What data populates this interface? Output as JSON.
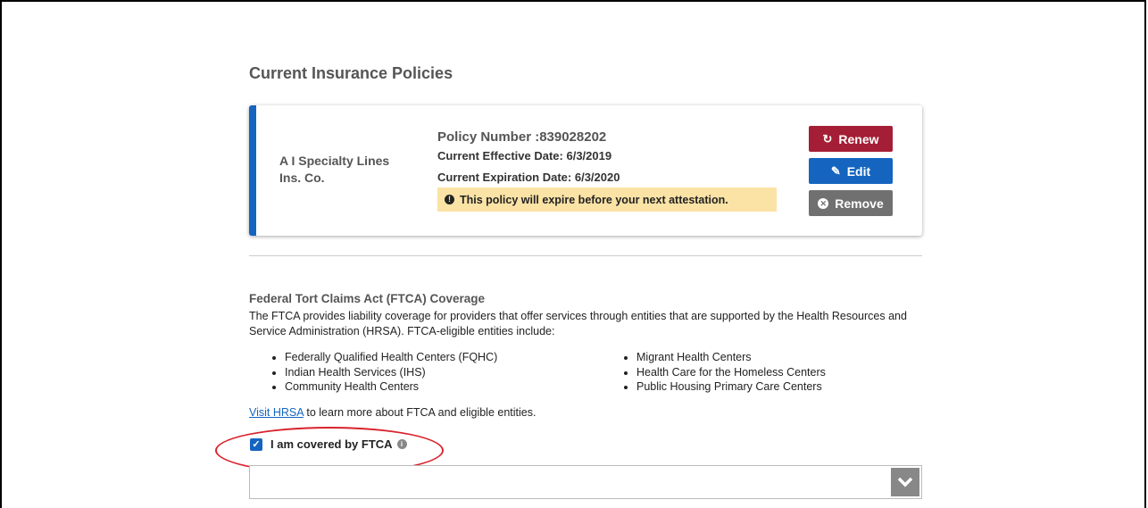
{
  "page": {
    "section_title": "Current Insurance Policies"
  },
  "policy": {
    "insurer": "A I Specialty Lines Ins. Co.",
    "policy_number": "Policy Number :839028202",
    "effective_date": "Current Effective Date: 6/3/2019",
    "expiration_date": "Current Expiration Date: 6/3/2020",
    "warning": "This policy will expire before your next attestation.",
    "renew_label": "Renew",
    "edit_label": "Edit",
    "remove_label": "Remove"
  },
  "ftca": {
    "title": "Federal Tort Claims Act (FTCA) Coverage",
    "description": "The FTCA provides liability coverage for providers that offer services through entities that are supported by the Health Resources and Service Administration (HRSA). FTCA-eligible entities include:",
    "entities_left": [
      "Federally Qualified Health Centers (FQHC)",
      "Indian Health Services (IHS)",
      "Community Health Centers"
    ],
    "entities_right": [
      "Migrant Health Centers",
      "Health Care for the Homeless Centers",
      "Public Housing Primary Care Centers"
    ],
    "link_text": "Visit HRSA",
    "link_suffix": " to learn more about FTCA and eligible entities.",
    "checkbox_label": "I am covered by FTCA",
    "checkbox_checked": true
  },
  "colors": {
    "accent_blue": "#1565c0",
    "renew_red": "#a41e35",
    "remove_gray": "#707070",
    "warning_bg": "#fbe3a6",
    "annotation_red": "#d9232d"
  }
}
